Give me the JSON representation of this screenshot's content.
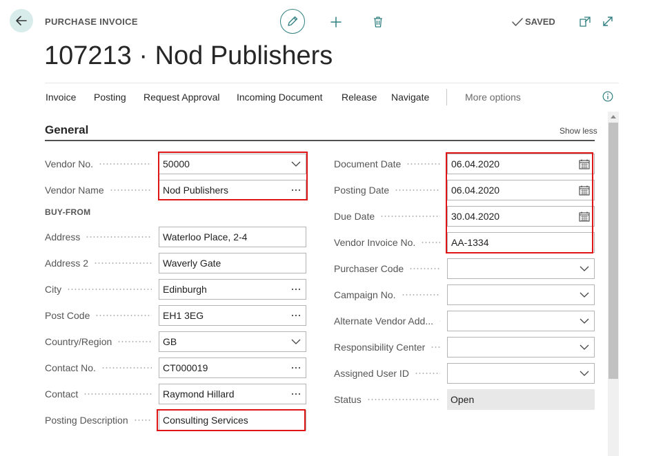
{
  "header": {
    "caption": "PURCHASE INVOICE",
    "title": "107213 · Nod Publishers",
    "status": "SAVED"
  },
  "actions": [
    {
      "label": "Invoice"
    },
    {
      "label": "Posting"
    },
    {
      "label": "Request Approval"
    },
    {
      "label": "Incoming Document"
    },
    {
      "label": "Release"
    },
    {
      "label": "Navigate"
    },
    {
      "label": "More options"
    }
  ],
  "section": {
    "title": "General",
    "toggle": "Show less",
    "group_buy_from": "BUY-FROM"
  },
  "left_fields": [
    {
      "label": "Vendor No.",
      "value": "50000"
    },
    {
      "label": "Vendor Name",
      "value": "Nod Publishers"
    },
    {
      "label": "Address",
      "value": "Waterloo Place, 2-4"
    },
    {
      "label": "Address 2",
      "value": "Waverly Gate"
    },
    {
      "label": "City",
      "value": "Edinburgh"
    },
    {
      "label": "Post Code",
      "value": "EH1 3EG"
    },
    {
      "label": "Country/Region",
      "value": "GB"
    },
    {
      "label": "Contact No.",
      "value": "CT000019"
    },
    {
      "label": "Contact",
      "value": "Raymond Hillard"
    },
    {
      "label": "Posting Description",
      "value": "Consulting Services"
    }
  ],
  "right_fields": [
    {
      "label": "Document Date",
      "value": "06.04.2020"
    },
    {
      "label": "Posting Date",
      "value": "06.04.2020"
    },
    {
      "label": "Due Date",
      "value": "30.04.2020"
    },
    {
      "label": "Vendor Invoice No.",
      "value": "AA-1334"
    },
    {
      "label": "Purchaser Code",
      "value": ""
    },
    {
      "label": "Campaign No.",
      "value": ""
    },
    {
      "label": "Alternate Vendor Add...",
      "value": ""
    },
    {
      "label": "Responsibility Center",
      "value": ""
    },
    {
      "label": "Assigned User ID",
      "value": ""
    },
    {
      "label": "Status",
      "value": "Open"
    }
  ],
  "icons": {
    "back": "arrow-left-icon",
    "edit": "pencil-icon",
    "new": "plus-icon",
    "delete": "trash-icon",
    "saved": "checkmark-icon",
    "open_new_window": "open-in-new-window-icon",
    "expand": "expand-icon",
    "info": "info-icon",
    "dropdown": "chevron-down-icon",
    "lookup": "ellipsis-icon",
    "date": "calendar-icon"
  },
  "colors": {
    "accent": "#2f7f80",
    "highlight": "#e01414",
    "readonly_bg": "#e8e8e8"
  }
}
